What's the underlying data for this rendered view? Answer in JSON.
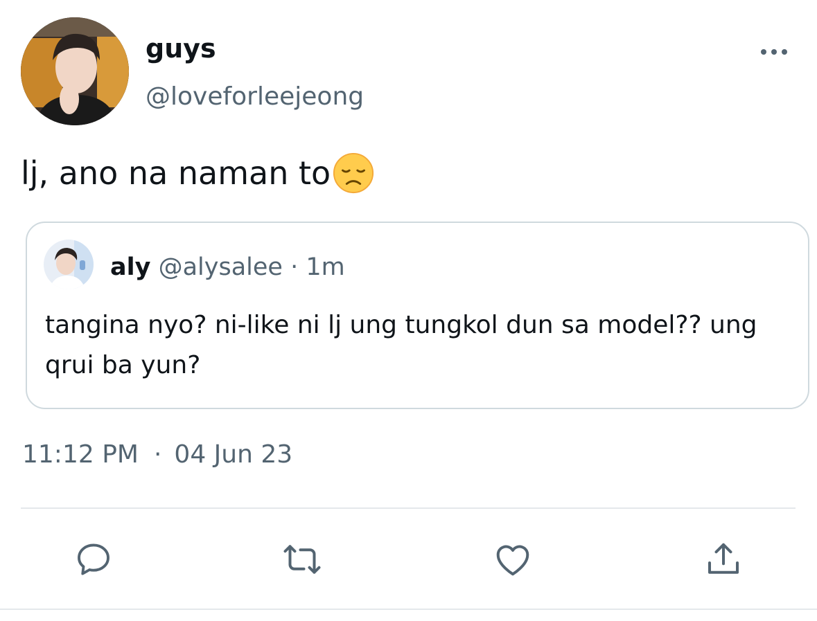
{
  "tweet": {
    "author": {
      "display_name": "guys",
      "handle": "@loveforleejeong",
      "avatar_icon": "profile-photo-avatar"
    },
    "text": "lj, ano na naman to",
    "emoji_icon": "disappointed-face-emoji",
    "more_icon": "more-options-icon",
    "timestamp": {
      "time": "11:12 PM",
      "separator": "·",
      "date": "04 Jun 23"
    }
  },
  "quote": {
    "display_name": "aly",
    "handle": "@alysalee",
    "separator": "·",
    "relative_time": "1m",
    "text": "tangina nyo? ni-like ni lj ung tungkol dun sa model?? ung qrui ba yun?",
    "avatar_icon": "profile-photo-avatar"
  },
  "actions": [
    {
      "name": "reply",
      "icon": "reply-icon"
    },
    {
      "name": "retweet",
      "icon": "retweet-icon"
    },
    {
      "name": "like",
      "icon": "heart-icon"
    },
    {
      "name": "share",
      "icon": "share-icon"
    }
  ],
  "colors": {
    "text_primary": "#0f1419",
    "text_secondary": "#536471",
    "border": "#cfd9de",
    "icon": "#536471"
  }
}
